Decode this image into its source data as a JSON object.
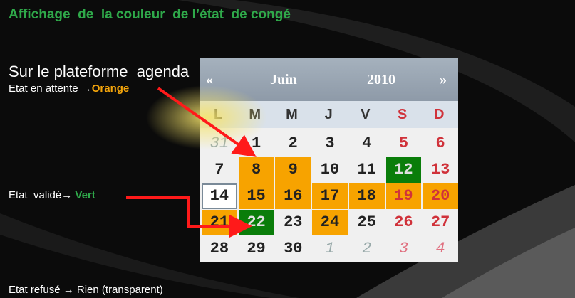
{
  "slide": {
    "title": "Affichage  de  la couleur  de l’état  de congé",
    "subtitle": "Sur le plateforme  agenda",
    "pending": {
      "prefix": "Etat en attente ",
      "arrow": "→",
      "color_word": "Orange"
    },
    "validated": {
      "prefix": "Etat  validé",
      "arrow": "→",
      "color_word": "Vert"
    },
    "refused": {
      "prefix": "Etat refusé ",
      "arrow": "→",
      "suffix": " Rien (transparent)"
    }
  },
  "calendar": {
    "prev": "«",
    "next": "»",
    "month": "Juin",
    "year": "2010",
    "weekdays": [
      "L",
      "M",
      "M",
      "J",
      "V",
      "S",
      "D"
    ],
    "weeks": [
      [
        {
          "d": "31",
          "o": true
        },
        {
          "d": "1"
        },
        {
          "d": "2"
        },
        {
          "d": "3"
        },
        {
          "d": "4"
        },
        {
          "d": "5"
        },
        {
          "d": "6"
        }
      ],
      [
        {
          "d": "7"
        },
        {
          "d": "8",
          "s": "orange"
        },
        {
          "d": "9",
          "s": "orange"
        },
        {
          "d": "10"
        },
        {
          "d": "11"
        },
        {
          "d": "12",
          "s": "green"
        },
        {
          "d": "13"
        }
      ],
      [
        {
          "d": "14",
          "t": true
        },
        {
          "d": "15",
          "s": "orange"
        },
        {
          "d": "16",
          "s": "orange"
        },
        {
          "d": "17",
          "s": "orange"
        },
        {
          "d": "18",
          "s": "orange"
        },
        {
          "d": "19",
          "s": "orange"
        },
        {
          "d": "20",
          "s": "orange"
        }
      ],
      [
        {
          "d": "21",
          "s": "orange"
        },
        {
          "d": "22",
          "s": "green"
        },
        {
          "d": "23"
        },
        {
          "d": "24",
          "s": "orange"
        },
        {
          "d": "25"
        },
        {
          "d": "26"
        },
        {
          "d": "27"
        }
      ],
      [
        {
          "d": "28"
        },
        {
          "d": "29"
        },
        {
          "d": "30"
        },
        {
          "d": "1",
          "o": true
        },
        {
          "d": "2",
          "o": true
        },
        {
          "d": "3",
          "o": true
        },
        {
          "d": "4",
          "o": true
        }
      ]
    ]
  },
  "colors": {
    "orange": "#f7a300",
    "green": "#0a7d0a",
    "arrow": "#ff1a1a",
    "title": "#2fa94a"
  }
}
